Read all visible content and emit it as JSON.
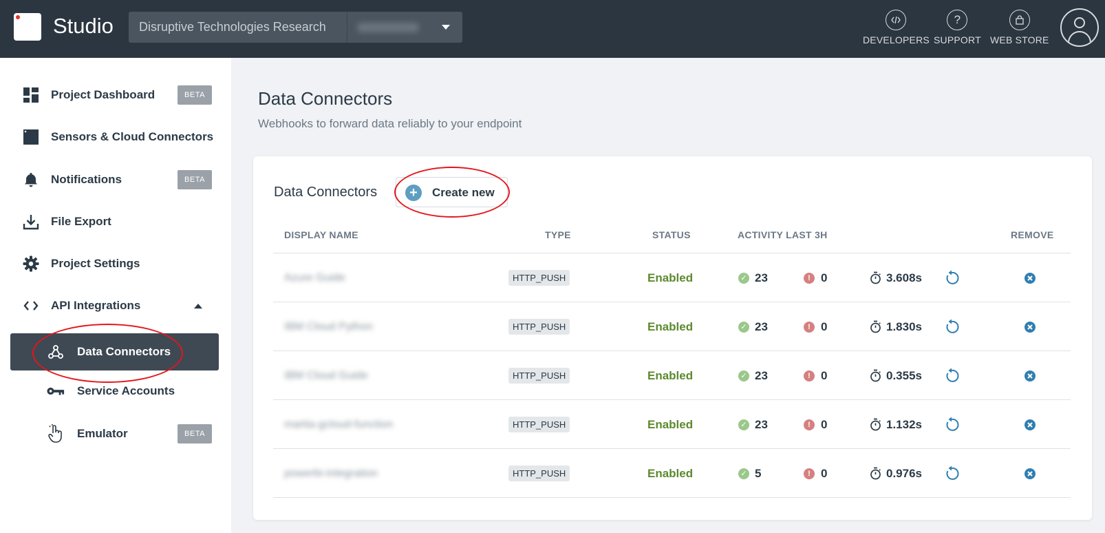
{
  "header": {
    "app_title": "Studio",
    "project_name": "Disruptive Technologies Research",
    "nav": [
      {
        "label": "DEVELOPERS",
        "icon": "code-icon"
      },
      {
        "label": "SUPPORT",
        "icon": "help-icon"
      },
      {
        "label": "WEB STORE",
        "icon": "shopping-bag-icon"
      }
    ]
  },
  "sidebar": {
    "items": [
      {
        "label": "Project Dashboard",
        "icon": "dashboard-icon",
        "badge": "BETA"
      },
      {
        "label": "Sensors & Cloud Connectors",
        "icon": "sensor-icon"
      },
      {
        "label": "Notifications",
        "icon": "bell-icon",
        "badge": "BETA"
      },
      {
        "label": "File Export",
        "icon": "download-icon"
      },
      {
        "label": "Project Settings",
        "icon": "gear-icon"
      },
      {
        "label": "API Integrations",
        "icon": "code-brackets-icon",
        "expanded": true
      },
      {
        "label": "Data Connectors",
        "icon": "webhook-icon",
        "active": true
      },
      {
        "label": "Service Accounts",
        "icon": "key-icon"
      },
      {
        "label": "Emulator",
        "icon": "touch-icon",
        "badge": "BETA"
      }
    ]
  },
  "main": {
    "title": "Data Connectors",
    "subtitle": "Webhooks to forward data reliably to your endpoint",
    "card_title": "Data Connectors",
    "create_label": "Create new",
    "columns": [
      "DISPLAY NAME",
      "TYPE",
      "STATUS",
      "ACTIVITY LAST 3H",
      "REMOVE"
    ],
    "rows": [
      {
        "name": "Azure Guide",
        "type": "HTTP_PUSH",
        "status": "Enabled",
        "success": "23",
        "errors": "0",
        "latency": "3.608s"
      },
      {
        "name": "IBM Cloud Python",
        "type": "HTTP_PUSH",
        "status": "Enabled",
        "success": "23",
        "errors": "0",
        "latency": "1.830s"
      },
      {
        "name": "IBM Cloud Guide",
        "type": "HTTP_PUSH",
        "status": "Enabled",
        "success": "23",
        "errors": "0",
        "latency": "0.355s"
      },
      {
        "name": "martia-gcloud-function",
        "type": "HTTP_PUSH",
        "status": "Enabled",
        "success": "23",
        "errors": "0",
        "latency": "1.132s"
      },
      {
        "name": "powerbi-integration",
        "type": "HTTP_PUSH",
        "status": "Enabled",
        "success": "5",
        "errors": "0",
        "latency": "0.976s"
      }
    ]
  },
  "colors": {
    "topbar": "#2c3640",
    "active_nav": "#3e4954",
    "status_enabled": "#5c8a2e",
    "success": "#9bc88a",
    "error": "#d68080",
    "accent": "#2f7fb0",
    "annotation": "#e3161c"
  }
}
